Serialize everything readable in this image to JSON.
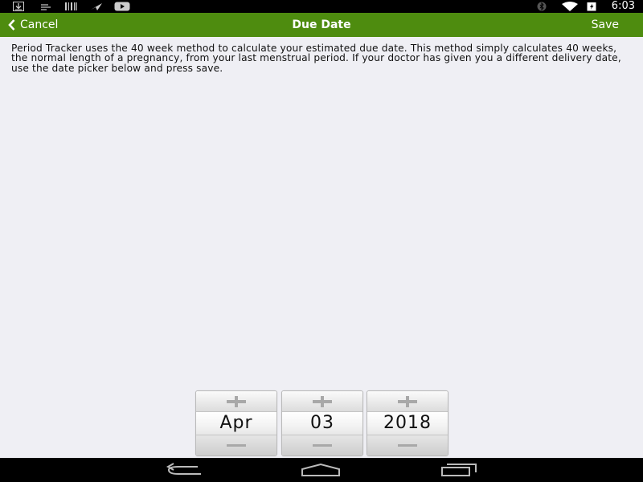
{
  "status_bar": {
    "time": "6:03",
    "left_icons": [
      "download-icon",
      "notes-icon",
      "barcode-icon",
      "send-icon",
      "youtube-icon"
    ],
    "right_icons": [
      "bluetooth-icon",
      "wifi-icon",
      "battery-icon"
    ]
  },
  "nav_bar": {
    "title": "Due Date",
    "cancel_label": "Cancel",
    "save_label": "Save",
    "color": "#4e8c0f"
  },
  "description": "Period Tracker uses the 40 week method to calculate your estimated due date. This method simply calculates 40 weeks, the normal length of a pregnancy, from your last menstrual period. If your doctor has given you a different delivery date, use the date picker below and press save.",
  "date_picker": {
    "month": "Apr",
    "day": "03",
    "year": "2018"
  },
  "system_nav": [
    "back-icon",
    "home-icon",
    "recents-icon"
  ]
}
